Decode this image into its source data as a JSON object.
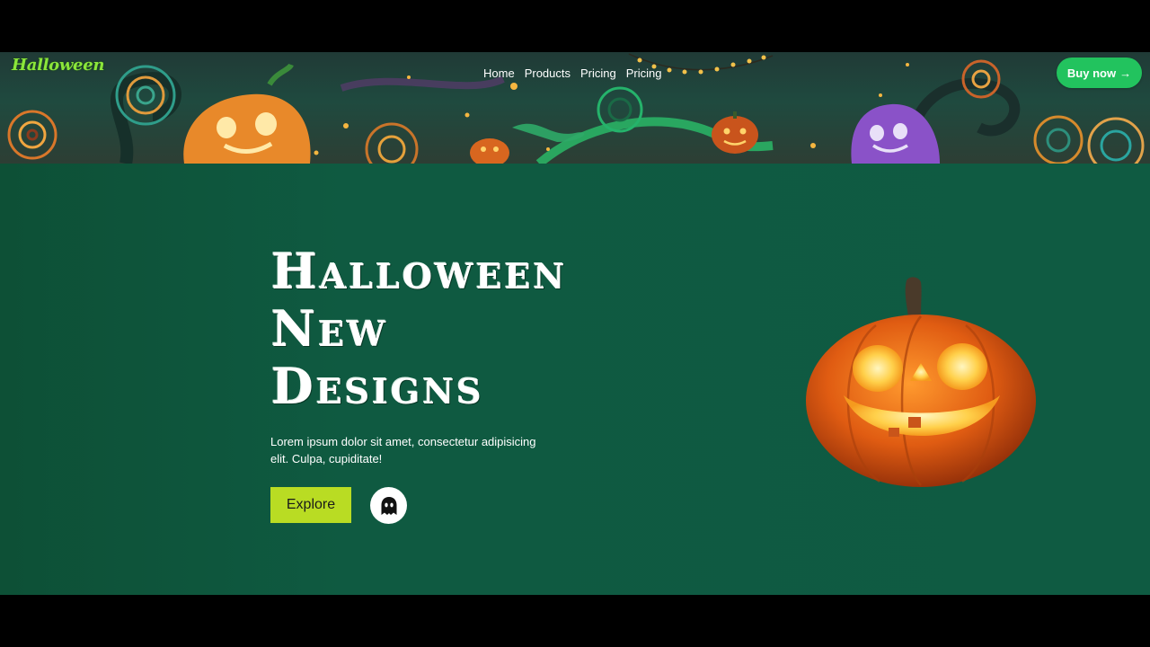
{
  "brand": {
    "logo_text": "Halloween"
  },
  "nav": {
    "items": [
      {
        "label": "Home"
      },
      {
        "label": "Products"
      },
      {
        "label": "Pricing"
      },
      {
        "label": "Pricing"
      }
    ]
  },
  "header": {
    "cta_label": "Buy now",
    "cta_icon": "arrow-right-icon"
  },
  "hero": {
    "title_lines": [
      "Halloween",
      "New",
      "Designs"
    ],
    "description": "Lorem ipsum dolor sit amet, consectetur adipisicing elit. Culpa, cupiditate!",
    "explore_label": "Explore",
    "ghost_icon": "ghost-icon",
    "image": "jack-o-lantern"
  },
  "colors": {
    "hero_background": "#0f5a41",
    "buy_button": "#22c35e",
    "explore_button": "#b9dc23",
    "logo": "#8be63a"
  }
}
